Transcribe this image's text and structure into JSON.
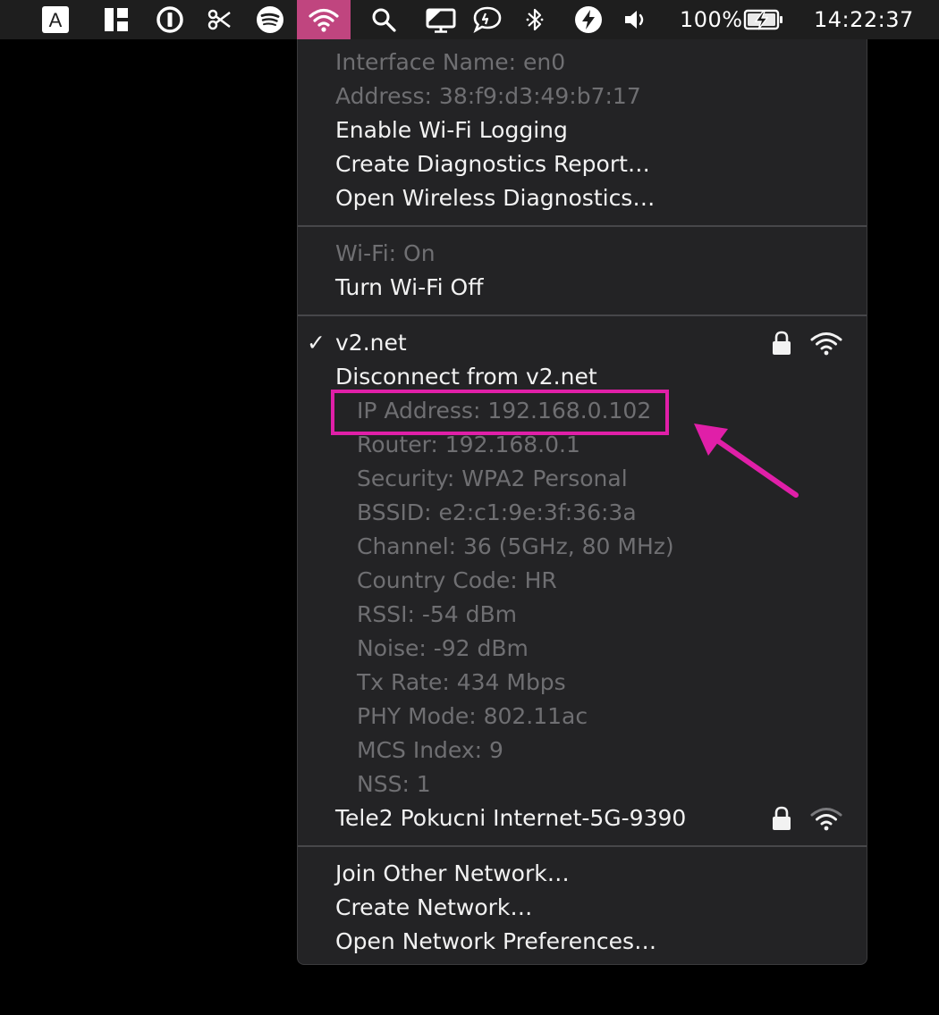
{
  "menubar": {
    "icons": [
      "a-app-icon",
      "layout-grid-icon",
      "password-manager-icon",
      "scissors-icon",
      "spotify-icon",
      "wifi-icon",
      "search-icon",
      "display-icon",
      "chat-bubble-icon",
      "bluetooth-icon",
      "bolt-icon",
      "volume-icon",
      "battery-charging-icon"
    ],
    "a_icon_letter": "A",
    "battery_percent": "100%",
    "clock": "14:22:37",
    "wifi_active_color": "#c0457f"
  },
  "menu": {
    "interface": {
      "name": "Interface Name: en0",
      "address": "Address: 38:f9:d3:49:b7:17",
      "enable_logging": "Enable Wi-Fi Logging",
      "diagnostics_report": "Create Diagnostics Report…",
      "wireless_diagnostics": "Open Wireless Diagnostics…"
    },
    "power": {
      "status": "Wi-Fi: On",
      "toggle": "Turn Wi-Fi Off"
    },
    "networks": {
      "connected": {
        "check": "✓",
        "name": "v2.net",
        "disconnect": "Disconnect from v2.net",
        "details": {
          "ip": "IP Address: 192.168.0.102",
          "router": "Router: 192.168.0.1",
          "security": "Security: WPA2 Personal",
          "bssid": "BSSID: e2:c1:9e:3f:36:3a",
          "channel": "Channel: 36 (5GHz, 80 MHz)",
          "country": "Country Code: HR",
          "rssi": "RSSI: -54 dBm",
          "noise": "Noise: -92 dBm",
          "tx_rate": "Tx Rate: 434 Mbps",
          "phy_mode": "PHY Mode: 802.11ac",
          "mcs_index": "MCS Index: 9",
          "nss": "NSS: 1"
        }
      },
      "other": {
        "name": "Tele2 Pokucni Internet-5G-9390"
      }
    },
    "footer": {
      "join_other": "Join Other Network…",
      "create_network": "Create Network…",
      "open_prefs": "Open Network Preferences…"
    }
  },
  "annotation": {
    "color": "#e01fa8"
  }
}
